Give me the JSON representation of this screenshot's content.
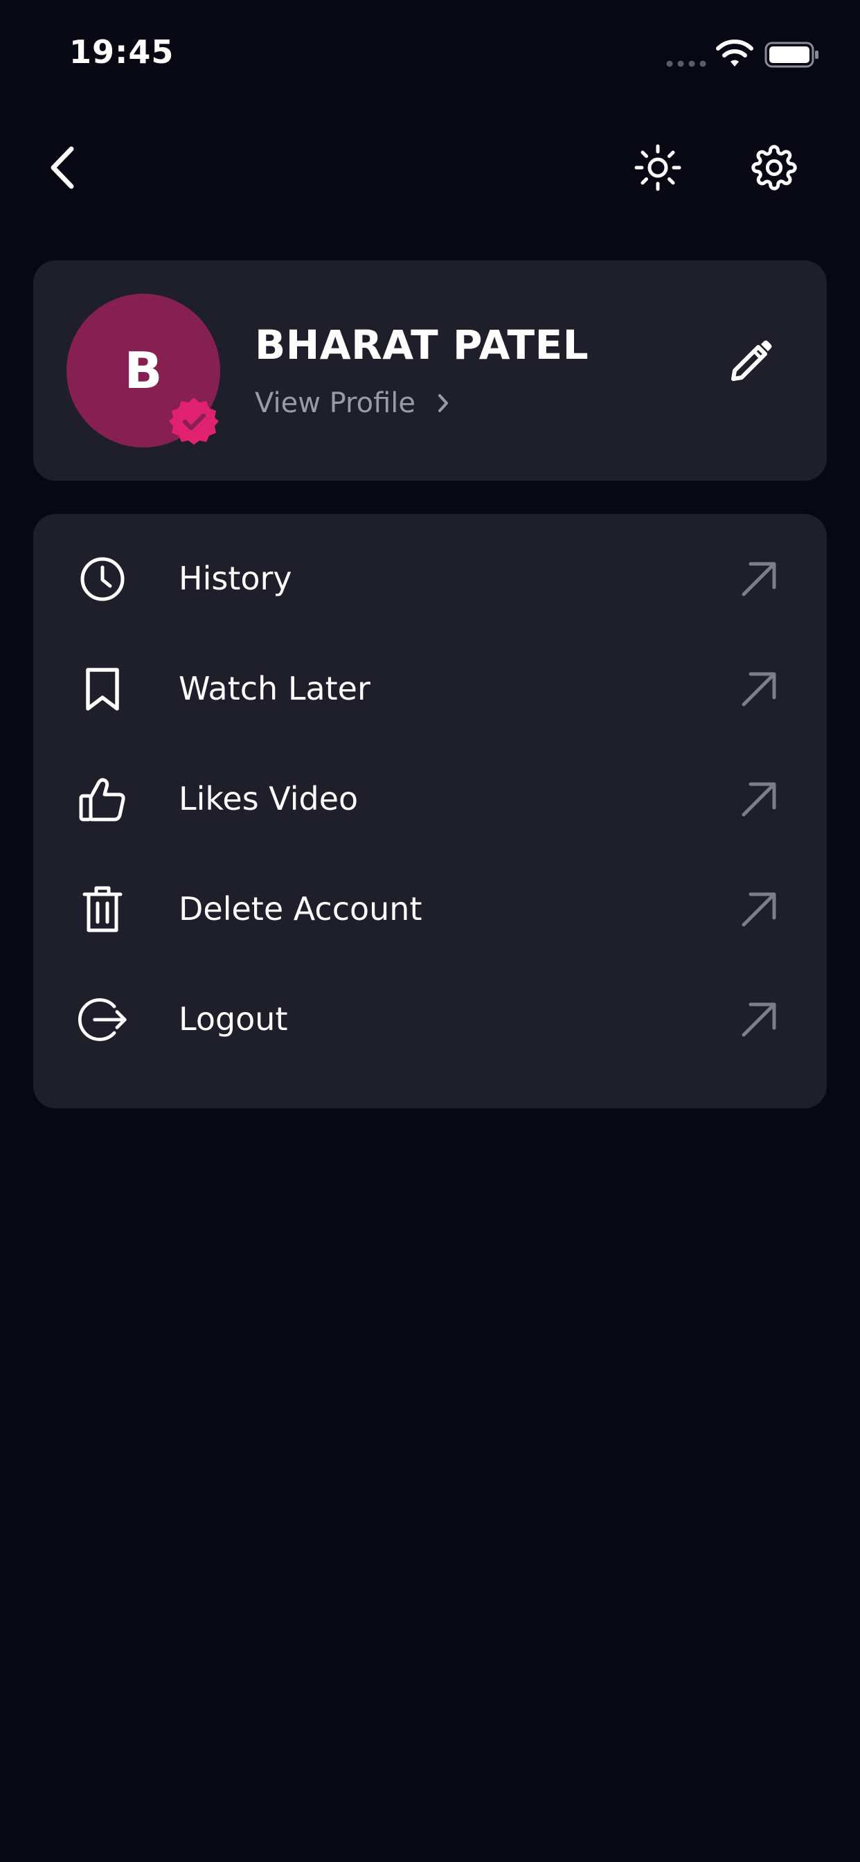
{
  "status_bar": {
    "time": "19:45",
    "signal_icon": "signal-dots-icon",
    "wifi_icon": "wifi-icon",
    "battery_icon": "battery-icon"
  },
  "topbar": {
    "back_icon": "back-chevron-icon",
    "theme_icon": "sun-icon",
    "settings_icon": "gear-icon"
  },
  "profile": {
    "initial": "B",
    "name": "BHARAT PATEL",
    "view_profile_label": "View Profile",
    "avatar_color": "#861f52",
    "badge_color": "#e0216f",
    "edit_icon": "pencil-icon"
  },
  "menu": {
    "items": [
      {
        "label": "History",
        "icon": "clock-icon"
      },
      {
        "label": "Watch Later",
        "icon": "bookmark-icon"
      },
      {
        "label": "Likes Video",
        "icon": "thumbs-up-icon"
      },
      {
        "label": "Delete Account",
        "icon": "trash-icon"
      },
      {
        "label": "Logout",
        "icon": "logout-icon"
      }
    ],
    "arrow_icon": "arrow-up-right-icon"
  },
  "colors": {
    "background": "#070814",
    "card": "#1e1f2a",
    "muted_text": "#9a9ba5"
  }
}
